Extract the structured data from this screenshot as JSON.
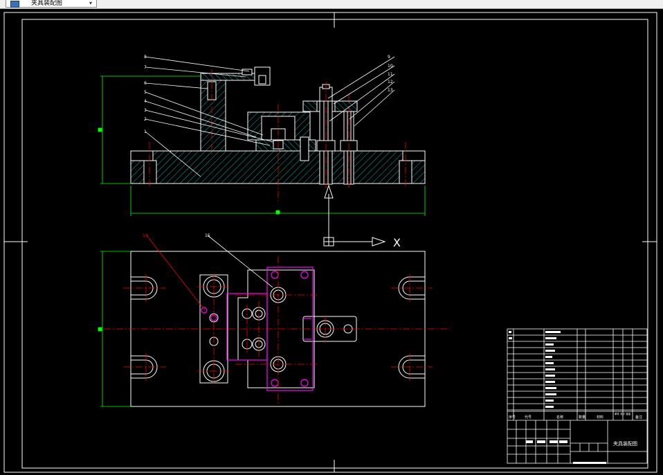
{
  "window": {
    "doc_tab_label": "夹具装配图",
    "doc_tab_icon": "drawing-document-icon",
    "dropdown_icon": "chevron-down-icon"
  },
  "colors": {
    "background": "#000000",
    "lines": "#ffffff",
    "centerlines": "#ff0000",
    "dimensions": "#00ff00",
    "hatch": "#00b3b3",
    "holes": "#ff00ff"
  },
  "drawing": {
    "ucs_axis_label": "X",
    "front_view_leaders": [
      "8",
      "7",
      "6",
      "5",
      "4",
      "3",
      "2",
      "1",
      "9",
      "10",
      "11",
      "12",
      "13"
    ],
    "top_view_leaders": [
      "14",
      "15"
    ]
  },
  "title_block": {
    "title": "夹具装配图",
    "header_seq": "序号",
    "header_code": "代号",
    "header_name": "名称",
    "header_qty": "数量",
    "header_material": "材料",
    "header_weight": "单件 总计 重量",
    "header_remark": "备注"
  }
}
